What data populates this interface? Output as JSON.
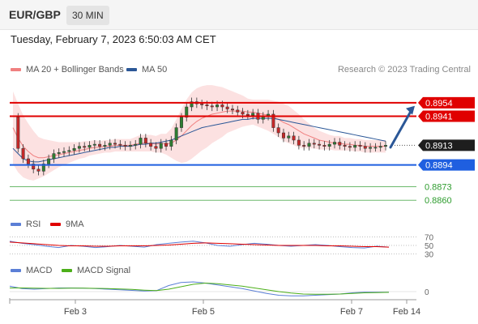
{
  "header": {
    "symbol": "EUR/GBP",
    "timeframe": "30 MIN"
  },
  "datetime": "Tuesday, February 7, 2023 6:50:03 AM CET",
  "legend": {
    "ma20_label": "MA 20 + Bollinger Bands",
    "ma50_label": "MA 50",
    "ma20_color": "#f08080",
    "ma50_color": "#2b5797",
    "rsi_label": "RSI",
    "nine_ma_label": "9MA",
    "rsi_color": "#5b7fd6",
    "nine_ma_color": "#e00000",
    "macd_label": "MACD",
    "macd_signal_label": "MACD Signal",
    "macd_color": "#5b7fd6",
    "macd_signal_color": "#4caf1a"
  },
  "credit": "Research © 2023 Trading Central",
  "chart_data": [
    {
      "type": "line",
      "panel": "price",
      "ylim": [
        0.885,
        0.8975
      ],
      "x_ticks": [
        "Feb 3",
        "Feb 5",
        "Feb 7",
        "Feb 14"
      ],
      "price_series": [
        0.894,
        0.891,
        0.89,
        0.8895,
        0.889,
        0.8888,
        0.8895,
        0.89,
        0.8905,
        0.8906,
        0.8907,
        0.8908,
        0.891,
        0.8912,
        0.8911,
        0.8913,
        0.8914,
        0.8912,
        0.8913,
        0.8915,
        0.8914,
        0.8913,
        0.8912,
        0.8913,
        0.8914,
        0.892,
        0.8915,
        0.8912,
        0.891,
        0.8915,
        0.8912,
        0.8918,
        0.893,
        0.894,
        0.895,
        0.8955,
        0.8953,
        0.8952,
        0.8951,
        0.895,
        0.8952,
        0.895,
        0.8948,
        0.8947,
        0.8945,
        0.8943,
        0.8942,
        0.8944,
        0.8938,
        0.8941,
        0.8943,
        0.893,
        0.8925,
        0.892,
        0.8922,
        0.8918,
        0.8913,
        0.8912,
        0.8915,
        0.8914,
        0.8913,
        0.8912,
        0.8914,
        0.8916,
        0.8913,
        0.8912,
        0.8911,
        0.8913,
        0.8912,
        0.891,
        0.8911,
        0.8911,
        0.8912,
        0.8913
      ],
      "ma50": [
        0.891,
        0.8905,
        0.89,
        0.8898,
        0.8897,
        0.8897,
        0.8898,
        0.8899,
        0.89,
        0.8901,
        0.8902,
        0.8903,
        0.8904,
        0.8905,
        0.8906,
        0.8907,
        0.8908,
        0.8909,
        0.891,
        0.8911,
        0.8911,
        0.8912,
        0.8912,
        0.8912,
        0.8913,
        0.8914,
        0.8914,
        0.8915,
        0.8915,
        0.8916,
        0.8917,
        0.8918,
        0.892,
        0.8922,
        0.8924,
        0.8926,
        0.8928,
        0.893,
        0.8931,
        0.8932,
        0.8933,
        0.8934,
        0.8935,
        0.8936,
        0.8937,
        0.8938,
        0.8938,
        0.8939,
        0.8939,
        0.8939,
        0.8939,
        0.8939,
        0.8938,
        0.8937,
        0.8936,
        0.8935,
        0.8934,
        0.8933,
        0.8932,
        0.8931,
        0.893,
        0.8929,
        0.8928,
        0.8927,
        0.8926,
        0.8925,
        0.8924,
        0.8923,
        0.8922,
        0.8921,
        0.892,
        0.8919,
        0.8918,
        0.8917
      ],
      "ma20": [
        0.893,
        0.892,
        0.8912,
        0.8907,
        0.8903,
        0.8901,
        0.8901,
        0.8902,
        0.8903,
        0.8904,
        0.8905,
        0.8906,
        0.8907,
        0.8908,
        0.8909,
        0.891,
        0.8911,
        0.8911,
        0.8912,
        0.8912,
        0.8913,
        0.8913,
        0.8913,
        0.8913,
        0.8914,
        0.8915,
        0.8915,
        0.8915,
        0.8914,
        0.8915,
        0.8914,
        0.8915,
        0.8918,
        0.8922,
        0.8927,
        0.8932,
        0.8936,
        0.8939,
        0.8941,
        0.8943,
        0.8944,
        0.8945,
        0.8946,
        0.8946,
        0.8946,
        0.8946,
        0.8945,
        0.8945,
        0.8944,
        0.8943,
        0.8942,
        0.894,
        0.8938,
        0.8935,
        0.8933,
        0.893,
        0.8927,
        0.8924,
        0.8922,
        0.892,
        0.8918,
        0.8917,
        0.8916,
        0.8915,
        0.8915,
        0.8914,
        0.8914,
        0.8913,
        0.8913,
        0.8912,
        0.8912,
        0.8912,
        0.8912,
        0.8912
      ],
      "bb_width": [
        0.0035,
        0.0033,
        0.003,
        0.0027,
        0.0024,
        0.002,
        0.0018,
        0.0016,
        0.0014,
        0.0012,
        0.0011,
        0.001,
        0.0009,
        0.0008,
        0.0008,
        0.0007,
        0.0007,
        0.0006,
        0.0006,
        0.0006,
        0.0006,
        0.0006,
        0.0006,
        0.0006,
        0.0007,
        0.0008,
        0.0008,
        0.0008,
        0.0008,
        0.0009,
        0.001,
        0.0014,
        0.002,
        0.0026,
        0.003,
        0.0032,
        0.0032,
        0.0031,
        0.003,
        0.0028,
        0.0026,
        0.0024,
        0.0021,
        0.0019,
        0.0017,
        0.0015,
        0.0013,
        0.0012,
        0.0013,
        0.0014,
        0.0015,
        0.0016,
        0.0017,
        0.0018,
        0.0018,
        0.0017,
        0.0016,
        0.0014,
        0.0012,
        0.001,
        0.0009,
        0.0008,
        0.0007,
        0.0007,
        0.0007,
        0.0006,
        0.0006,
        0.0006,
        0.0006,
        0.0006,
        0.0006,
        0.0006,
        0.0006,
        0.0006
      ],
      "levels": [
        {
          "value": 0.8954,
          "label": "0.8954",
          "color": "#e00000",
          "style": "box"
        },
        {
          "value": 0.8941,
          "label": "0.8941",
          "color": "#e00000",
          "style": "box"
        },
        {
          "value": 0.8913,
          "label": "0.8913",
          "color": "#222222",
          "style": "box-dark"
        },
        {
          "value": 0.8894,
          "label": "0.8894",
          "color": "#1f5fe0",
          "style": "box"
        },
        {
          "value": 0.8873,
          "label": "0.8873",
          "color": "#2e9c2e",
          "style": "text"
        },
        {
          "value": 0.886,
          "label": "0.8860",
          "color": "#2e9c2e",
          "style": "text"
        }
      ],
      "arrow": {
        "from": 0.8911,
        "to": 0.8951,
        "color": "#2b5797"
      }
    },
    {
      "type": "line",
      "panel": "rsi",
      "ylim": [
        25,
        75
      ],
      "ticks": [
        "70",
        "50",
        "30"
      ],
      "series": [
        {
          "name": "RSI",
          "values": [
            60,
            55,
            52,
            48,
            45,
            50,
            48,
            45,
            47,
            50,
            48,
            46,
            52,
            55,
            58,
            60,
            56,
            50,
            48,
            52,
            55,
            53,
            50,
            48,
            50,
            52,
            50,
            47,
            45,
            44,
            48,
            46
          ]
        },
        {
          "name": "9MA",
          "values": [
            58,
            56,
            54,
            52,
            50,
            49,
            49,
            48,
            48,
            49,
            49,
            49,
            50,
            51,
            53,
            55,
            56,
            55,
            54,
            53,
            52,
            51,
            50,
            50,
            50,
            50,
            49,
            49,
            48,
            47,
            47,
            46
          ]
        }
      ]
    },
    {
      "type": "line",
      "panel": "macd",
      "ylim": [
        -1,
        1
      ],
      "ticks": [
        "0"
      ],
      "series": [
        {
          "name": "MACD",
          "values": [
            0.45,
            0.25,
            0.2,
            0.25,
            0.3,
            0.3,
            0.28,
            0.25,
            0.2,
            0.15,
            0.1,
            0.05,
            0.08,
            0.5,
            0.75,
            0.8,
            0.7,
            0.55,
            0.4,
            0.25,
            0.05,
            -0.15,
            -0.3,
            -0.35,
            -0.35,
            -0.3,
            -0.25,
            -0.2,
            -0.1,
            -0.05,
            -0.05,
            -0.05
          ]
        },
        {
          "name": "MACD Signal",
          "values": [
            0.3,
            0.3,
            0.28,
            0.27,
            0.27,
            0.28,
            0.28,
            0.27,
            0.25,
            0.22,
            0.18,
            0.12,
            0.08,
            0.2,
            0.4,
            0.6,
            0.7,
            0.65,
            0.55,
            0.45,
            0.3,
            0.15,
            0.0,
            -0.12,
            -0.2,
            -0.22,
            -0.22,
            -0.2,
            -0.15,
            -0.1,
            -0.08,
            -0.06
          ]
        }
      ]
    }
  ]
}
